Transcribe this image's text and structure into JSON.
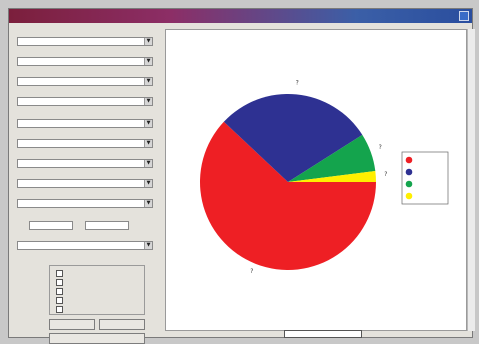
{
  "window": {
    "title": ""
  },
  "panel": {
    "fields": [
      {
        "label": "",
        "value": ""
      },
      {
        "label": "",
        "value": ""
      },
      {
        "label": "",
        "value": ""
      },
      {
        "label": "",
        "value": ""
      },
      {
        "label": "",
        "value": ""
      },
      {
        "label": "",
        "value": ""
      },
      {
        "label": "",
        "value": ""
      },
      {
        "label": "",
        "value": ""
      },
      {
        "label": "",
        "value": ""
      }
    ],
    "small_inputs": [
      {
        "label": "",
        "value": ""
      },
      {
        "label": "",
        "value": ""
      }
    ],
    "last_field": {
      "label": "",
      "value": ""
    },
    "group": {
      "title": "",
      "options": [
        "",
        "",
        "",
        "",
        ""
      ]
    },
    "buttons": {
      "left": "",
      "right": "",
      "primary": ""
    }
  },
  "chart_caption": "",
  "chart_data": {
    "type": "pie",
    "title": "",
    "slices": [
      {
        "label": "?",
        "value": 62.0,
        "color": "#ee1f24"
      },
      {
        "label": "?",
        "value": 29.0,
        "color": "#2e3192"
      },
      {
        "label": "?",
        "value": 7.0,
        "color": "#14a44d"
      },
      {
        "label": "?",
        "value": 2.0,
        "color": "#ffef00"
      }
    ],
    "legend": {
      "position": "right",
      "entries": [
        {
          "label": "",
          "color": "#ee1f24"
        },
        {
          "label": "",
          "color": "#2e3192"
        },
        {
          "label": "",
          "color": "#14a44d"
        },
        {
          "label": "",
          "color": "#ffef00"
        }
      ]
    }
  }
}
